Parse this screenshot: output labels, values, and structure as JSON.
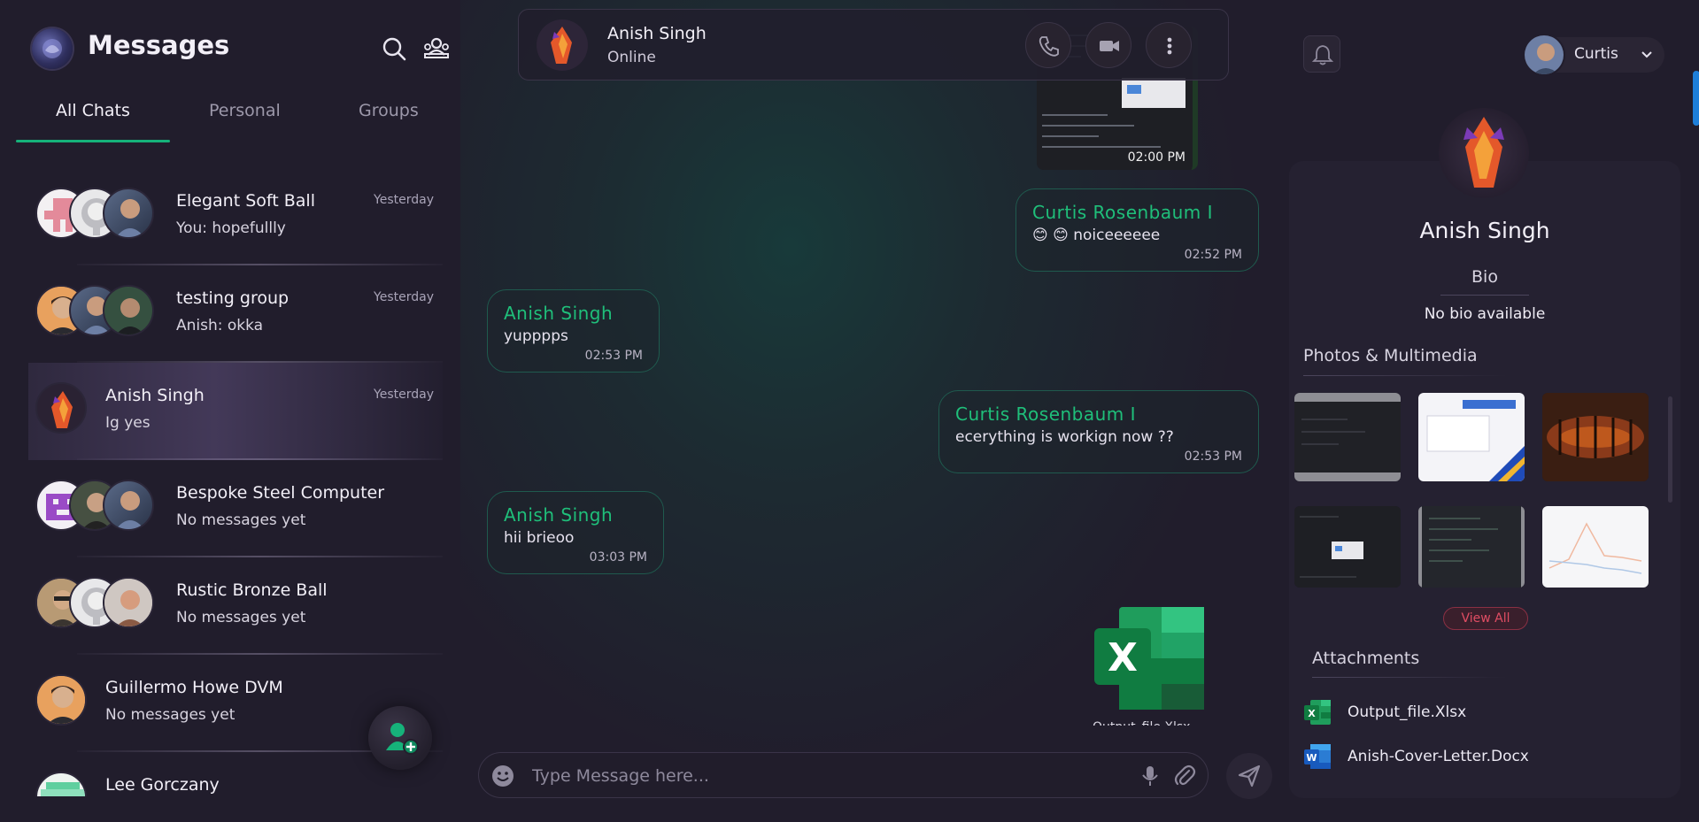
{
  "app": {
    "title": "Messages"
  },
  "tabs": [
    {
      "label": "All Chats",
      "active": true
    },
    {
      "label": "Personal",
      "active": false
    },
    {
      "label": "Groups",
      "active": false
    }
  ],
  "chats": [
    {
      "name": "Elegant Soft Ball",
      "preview": "You: hopefullly",
      "time": "Yesterday",
      "group": true
    },
    {
      "name": "testing group",
      "preview": "Anish: okka",
      "time": "Yesterday",
      "group": true
    },
    {
      "name": "Anish Singh",
      "preview": "Ig yes",
      "time": "Yesterday",
      "group": false,
      "selected": true
    },
    {
      "name": "Bespoke Steel Computer",
      "preview": "No messages yet",
      "time": "",
      "group": true
    },
    {
      "name": "Rustic Bronze Ball",
      "preview": "No messages yet",
      "time": "",
      "group": true
    },
    {
      "name": "Guillermo Howe DVM",
      "preview": "No messages yet",
      "time": "",
      "group": false
    },
    {
      "name": "Lee Gorczany",
      "preview": "",
      "time": "",
      "group": false
    }
  ],
  "conversation": {
    "contact_name": "Anish Singh",
    "contact_status": "Online",
    "image_time": "02:00 PM",
    "messages": [
      {
        "sender": "Curtis Rosenbaum I",
        "text": "😊 😊 noiceeeeee",
        "time": "02:52 PM",
        "outgoing": true
      },
      {
        "sender": "Anish Singh",
        "text": "yupppps",
        "time": "02:53 PM",
        "outgoing": false
      },
      {
        "sender": "Curtis Rosenbaum I",
        "text": "ecerything is workign now ??",
        "time": "02:53 PM",
        "outgoing": true
      },
      {
        "sender": "Anish Singh",
        "text": "hii brieoo",
        "time": "03:03 PM",
        "outgoing": false
      }
    ],
    "file_caption": "Output_file.Xlsx"
  },
  "composer": {
    "placeholder": "Type Message here..."
  },
  "current_user": {
    "name": "Curtis"
  },
  "profile": {
    "name": "Anish Singh",
    "bio_label": "Bio",
    "bio": "No bio available",
    "media_label": "Photos & Multimedia",
    "view_all": "View All",
    "attachments_label": "Attachments",
    "attachments": [
      {
        "name": "Output_file.Xlsx",
        "type": "xlsx"
      },
      {
        "name": "Anish-Cover-Letter.Docx",
        "type": "docx"
      }
    ]
  },
  "colors": {
    "accent_green": "#16b27a",
    "background": "#211d2c",
    "bubble_border": "#1f5a4e",
    "view_all": "#e04d63",
    "scroll_accent": "#1e7fd9"
  },
  "icons": [
    "search-icon",
    "new-group-icon",
    "phone-icon",
    "video-icon",
    "more-vertical-icon",
    "bell-icon",
    "chevron-down-icon",
    "emoji-icon",
    "mic-icon",
    "attach-icon",
    "send-icon",
    "add-contact-icon",
    "excel-icon",
    "word-icon"
  ]
}
